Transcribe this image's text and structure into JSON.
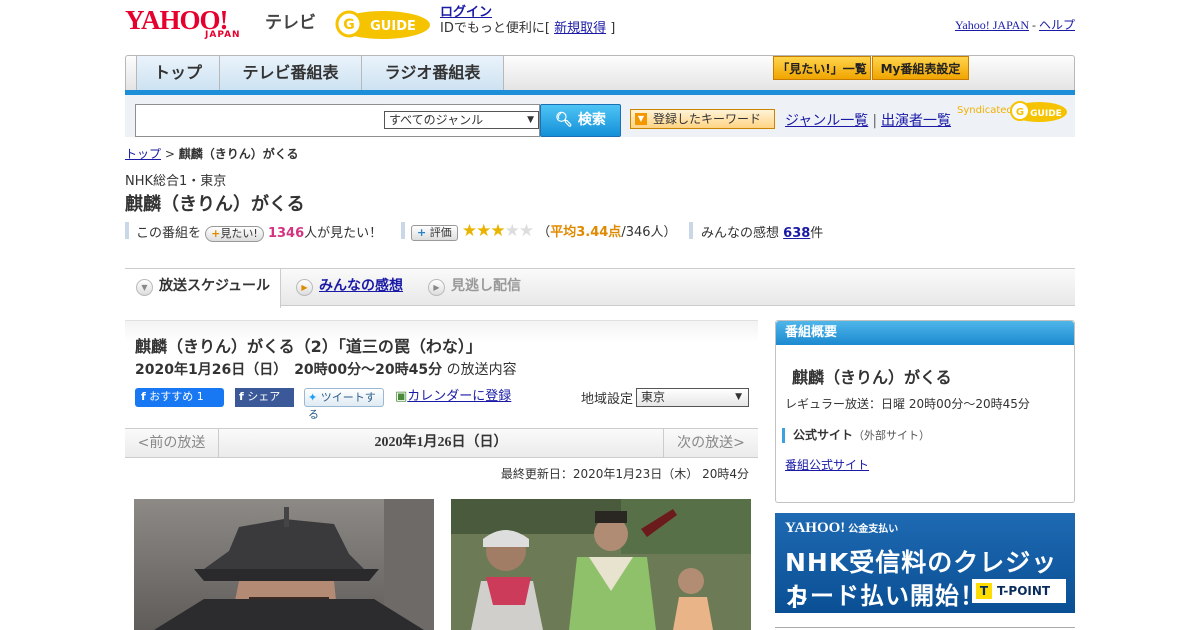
{
  "header": {
    "logo_text": "YAHOO!",
    "logo_sub": "JAPAN",
    "section": "テレビ",
    "gguide_text": "G-GUIDE",
    "login_label": "ログイン",
    "login_prompt_prefix": "IDでもっと便利に[",
    "signup_label": "新規取得",
    "login_prompt_suffix": "]",
    "yahoo_japan_link": "Yahoo! JAPAN",
    "help_sep": " - ",
    "help_link": "ヘルプ"
  },
  "nav": {
    "tabs": [
      "トップ",
      "テレビ番組表",
      "ラジオ番組表"
    ],
    "mitai_list": "「見たい!」一覧",
    "my_schedule": "My番組表設定"
  },
  "search": {
    "input_value": "",
    "genre_selected": "すべてのジャンル",
    "search_button": "検索",
    "keyword_button": "登録したキーワード",
    "genre_list_link": "ジャンル一覧",
    "cast_list_link": "出演者一覧",
    "syndicated": "Syndicated"
  },
  "breadcrumb": {
    "top": "トップ",
    "sep": " > ",
    "current": "麒麟（きりん）がくる"
  },
  "program": {
    "channel": "NHK総合1・東京",
    "title": "麒麟（きりん）がくる",
    "mitai_prefix": "この番組を",
    "mitai_button": "見たい!",
    "mitai_count": "1346",
    "mitai_suffix": "人が見たい！",
    "rate_button": "評価",
    "rating_stars": 3,
    "rating_max": 5,
    "avg_open": "（",
    "avg_label": "平均3.44点",
    "avg_count": "/346人）",
    "review_prefix": "みんなの感想",
    "review_count": "638",
    "review_suffix": "件"
  },
  "tabs": {
    "schedule": "放送スケジュール",
    "reviews": "みんなの感想",
    "missed": "見逃し配信"
  },
  "episode": {
    "title": "麒麟（きりん）がくる（2）「道三の罠（わな）」",
    "date": "2020年1月26日（日）　20時00分～20時45分",
    "date_suffix": "の放送内容",
    "fb_recommend": "おすすめ 1",
    "fb_share": "シェア",
    "tweet": "ツイートする",
    "calendar": "カレンダーに登録",
    "region_label": "地域設定",
    "region_value": "東京"
  },
  "day_nav": {
    "prev": "<前の放送",
    "current": "2020年1月26日（日）",
    "next": "次の放送>"
  },
  "updated": "最終更新日：2020年1月23日（木） 20時4分",
  "side": {
    "header": "番組概要",
    "title": "麒麟（きりん）がくる",
    "regular": "レギュラー放送：日曜 20時00分～20時45分",
    "official_label": "公式サイト",
    "official_note": "（外部サイト）",
    "official_link": "番組公式サイト"
  },
  "ad": {
    "brand": "YAHOO!",
    "brand_sub": "公金支払い",
    "line1": "NHK受信料のクレジット",
    "line2": "カード払い開始！",
    "tpoint": "T-POINT"
  },
  "colors": {
    "accent_blue": "#1d8fd8",
    "brand_red": "#e6002d",
    "star": "#e9b400",
    "pink_count": "#d43381"
  }
}
